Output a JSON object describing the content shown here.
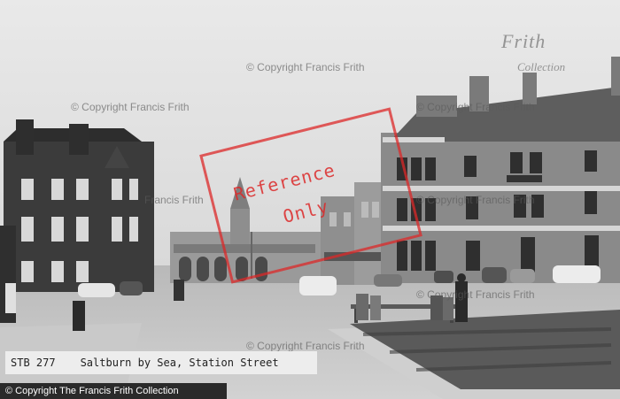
{
  "photo": {
    "caption_id": "STB 277",
    "caption_title": "Saltburn by Sea, Station Street",
    "copyright_bar": "© Copyright The Francis Frith Collection",
    "watermark_text": "© Copyright Francis Frith",
    "watermark_partial": "Francis Frith",
    "stamp_line1": "Reference",
    "stamp_line2": "Only",
    "logo_line1": "Frith",
    "logo_line2": "Collection",
    "colors": {
      "stamp": "#dc2828",
      "bar": "#2a2a2a"
    }
  }
}
